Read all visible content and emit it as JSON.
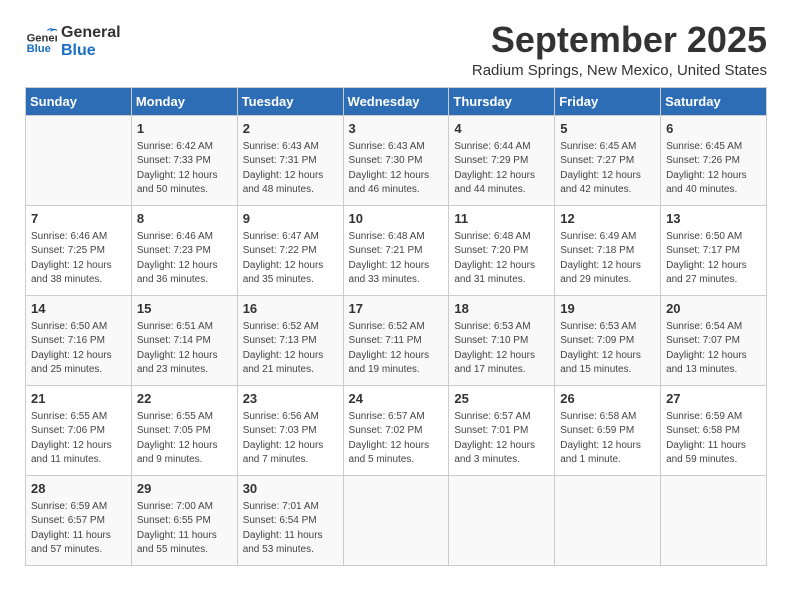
{
  "logo": {
    "line1": "General",
    "line2": "Blue"
  },
  "title": "September 2025",
  "location": "Radium Springs, New Mexico, United States",
  "headers": [
    "Sunday",
    "Monday",
    "Tuesday",
    "Wednesday",
    "Thursday",
    "Friday",
    "Saturday"
  ],
  "weeks": [
    [
      {
        "day": "",
        "info": ""
      },
      {
        "day": "1",
        "info": "Sunrise: 6:42 AM\nSunset: 7:33 PM\nDaylight: 12 hours\nand 50 minutes."
      },
      {
        "day": "2",
        "info": "Sunrise: 6:43 AM\nSunset: 7:31 PM\nDaylight: 12 hours\nand 48 minutes."
      },
      {
        "day": "3",
        "info": "Sunrise: 6:43 AM\nSunset: 7:30 PM\nDaylight: 12 hours\nand 46 minutes."
      },
      {
        "day": "4",
        "info": "Sunrise: 6:44 AM\nSunset: 7:29 PM\nDaylight: 12 hours\nand 44 minutes."
      },
      {
        "day": "5",
        "info": "Sunrise: 6:45 AM\nSunset: 7:27 PM\nDaylight: 12 hours\nand 42 minutes."
      },
      {
        "day": "6",
        "info": "Sunrise: 6:45 AM\nSunset: 7:26 PM\nDaylight: 12 hours\nand 40 minutes."
      }
    ],
    [
      {
        "day": "7",
        "info": "Sunrise: 6:46 AM\nSunset: 7:25 PM\nDaylight: 12 hours\nand 38 minutes."
      },
      {
        "day": "8",
        "info": "Sunrise: 6:46 AM\nSunset: 7:23 PM\nDaylight: 12 hours\nand 36 minutes."
      },
      {
        "day": "9",
        "info": "Sunrise: 6:47 AM\nSunset: 7:22 PM\nDaylight: 12 hours\nand 35 minutes."
      },
      {
        "day": "10",
        "info": "Sunrise: 6:48 AM\nSunset: 7:21 PM\nDaylight: 12 hours\nand 33 minutes."
      },
      {
        "day": "11",
        "info": "Sunrise: 6:48 AM\nSunset: 7:20 PM\nDaylight: 12 hours\nand 31 minutes."
      },
      {
        "day": "12",
        "info": "Sunrise: 6:49 AM\nSunset: 7:18 PM\nDaylight: 12 hours\nand 29 minutes."
      },
      {
        "day": "13",
        "info": "Sunrise: 6:50 AM\nSunset: 7:17 PM\nDaylight: 12 hours\nand 27 minutes."
      }
    ],
    [
      {
        "day": "14",
        "info": "Sunrise: 6:50 AM\nSunset: 7:16 PM\nDaylight: 12 hours\nand 25 minutes."
      },
      {
        "day": "15",
        "info": "Sunrise: 6:51 AM\nSunset: 7:14 PM\nDaylight: 12 hours\nand 23 minutes."
      },
      {
        "day": "16",
        "info": "Sunrise: 6:52 AM\nSunset: 7:13 PM\nDaylight: 12 hours\nand 21 minutes."
      },
      {
        "day": "17",
        "info": "Sunrise: 6:52 AM\nSunset: 7:11 PM\nDaylight: 12 hours\nand 19 minutes."
      },
      {
        "day": "18",
        "info": "Sunrise: 6:53 AM\nSunset: 7:10 PM\nDaylight: 12 hours\nand 17 minutes."
      },
      {
        "day": "19",
        "info": "Sunrise: 6:53 AM\nSunset: 7:09 PM\nDaylight: 12 hours\nand 15 minutes."
      },
      {
        "day": "20",
        "info": "Sunrise: 6:54 AM\nSunset: 7:07 PM\nDaylight: 12 hours\nand 13 minutes."
      }
    ],
    [
      {
        "day": "21",
        "info": "Sunrise: 6:55 AM\nSunset: 7:06 PM\nDaylight: 12 hours\nand 11 minutes."
      },
      {
        "day": "22",
        "info": "Sunrise: 6:55 AM\nSunset: 7:05 PM\nDaylight: 12 hours\nand 9 minutes."
      },
      {
        "day": "23",
        "info": "Sunrise: 6:56 AM\nSunset: 7:03 PM\nDaylight: 12 hours\nand 7 minutes."
      },
      {
        "day": "24",
        "info": "Sunrise: 6:57 AM\nSunset: 7:02 PM\nDaylight: 12 hours\nand 5 minutes."
      },
      {
        "day": "25",
        "info": "Sunrise: 6:57 AM\nSunset: 7:01 PM\nDaylight: 12 hours\nand 3 minutes."
      },
      {
        "day": "26",
        "info": "Sunrise: 6:58 AM\nSunset: 6:59 PM\nDaylight: 12 hours\nand 1 minute."
      },
      {
        "day": "27",
        "info": "Sunrise: 6:59 AM\nSunset: 6:58 PM\nDaylight: 11 hours\nand 59 minutes."
      }
    ],
    [
      {
        "day": "28",
        "info": "Sunrise: 6:59 AM\nSunset: 6:57 PM\nDaylight: 11 hours\nand 57 minutes."
      },
      {
        "day": "29",
        "info": "Sunrise: 7:00 AM\nSunset: 6:55 PM\nDaylight: 11 hours\nand 55 minutes."
      },
      {
        "day": "30",
        "info": "Sunrise: 7:01 AM\nSunset: 6:54 PM\nDaylight: 11 hours\nand 53 minutes."
      },
      {
        "day": "",
        "info": ""
      },
      {
        "day": "",
        "info": ""
      },
      {
        "day": "",
        "info": ""
      },
      {
        "day": "",
        "info": ""
      }
    ]
  ]
}
